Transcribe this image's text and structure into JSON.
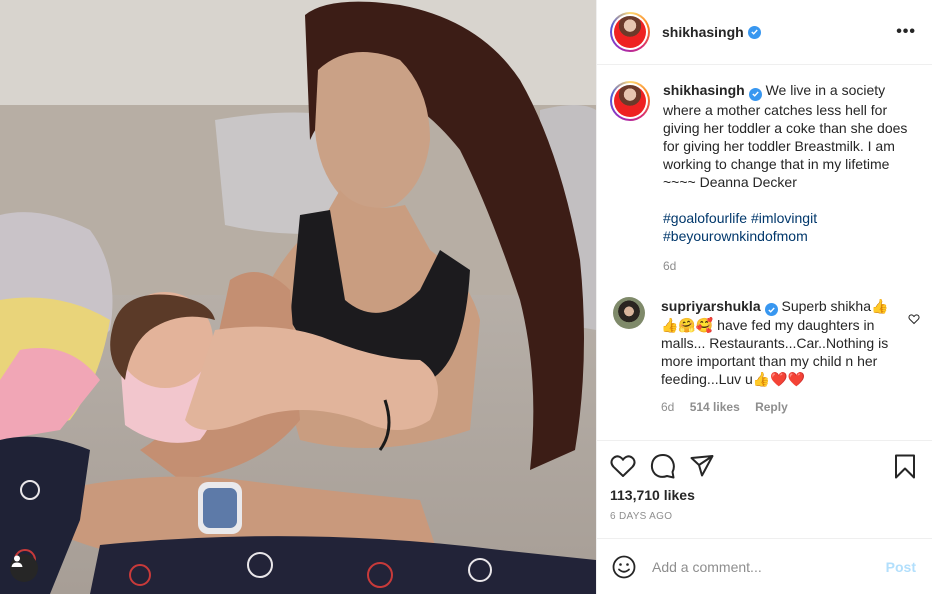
{
  "post": {
    "username": "shikhasingh",
    "verified": true,
    "more_icon": "more-horizontal-icon",
    "caption": {
      "username": "shikhasingh",
      "text": "We live in a society where a mother catches less hell for giving her toddler a coke than she does for giving her toddler Breastmilk. I am working to change that in my lifetime ~~~~ Deanna Decker",
      "hashtags": [
        "#goalofourlife",
        "#imlovingit",
        "#beyourownkindofmom"
      ],
      "age": "6d"
    },
    "comments": [
      {
        "username": "supriyarshukla",
        "verified": true,
        "text": "Superb shikha👍👍🤗🥰 have fed my daughters in malls... Restaurants...Car..Nothing is more important than my child n her feeding...Luv u👍❤️❤️",
        "age": "6d",
        "likes": "514 likes",
        "reply": "Reply"
      }
    ],
    "likes": "113,710 likes",
    "date": "6 DAYS AGO",
    "add_comment": {
      "placeholder": "Add a comment...",
      "post_label": "Post"
    },
    "colors": {
      "accent": "#3897f0",
      "hashtag": "#00376b",
      "post_disabled": "#b2dffc",
      "muted": "#8e8e8e"
    }
  }
}
